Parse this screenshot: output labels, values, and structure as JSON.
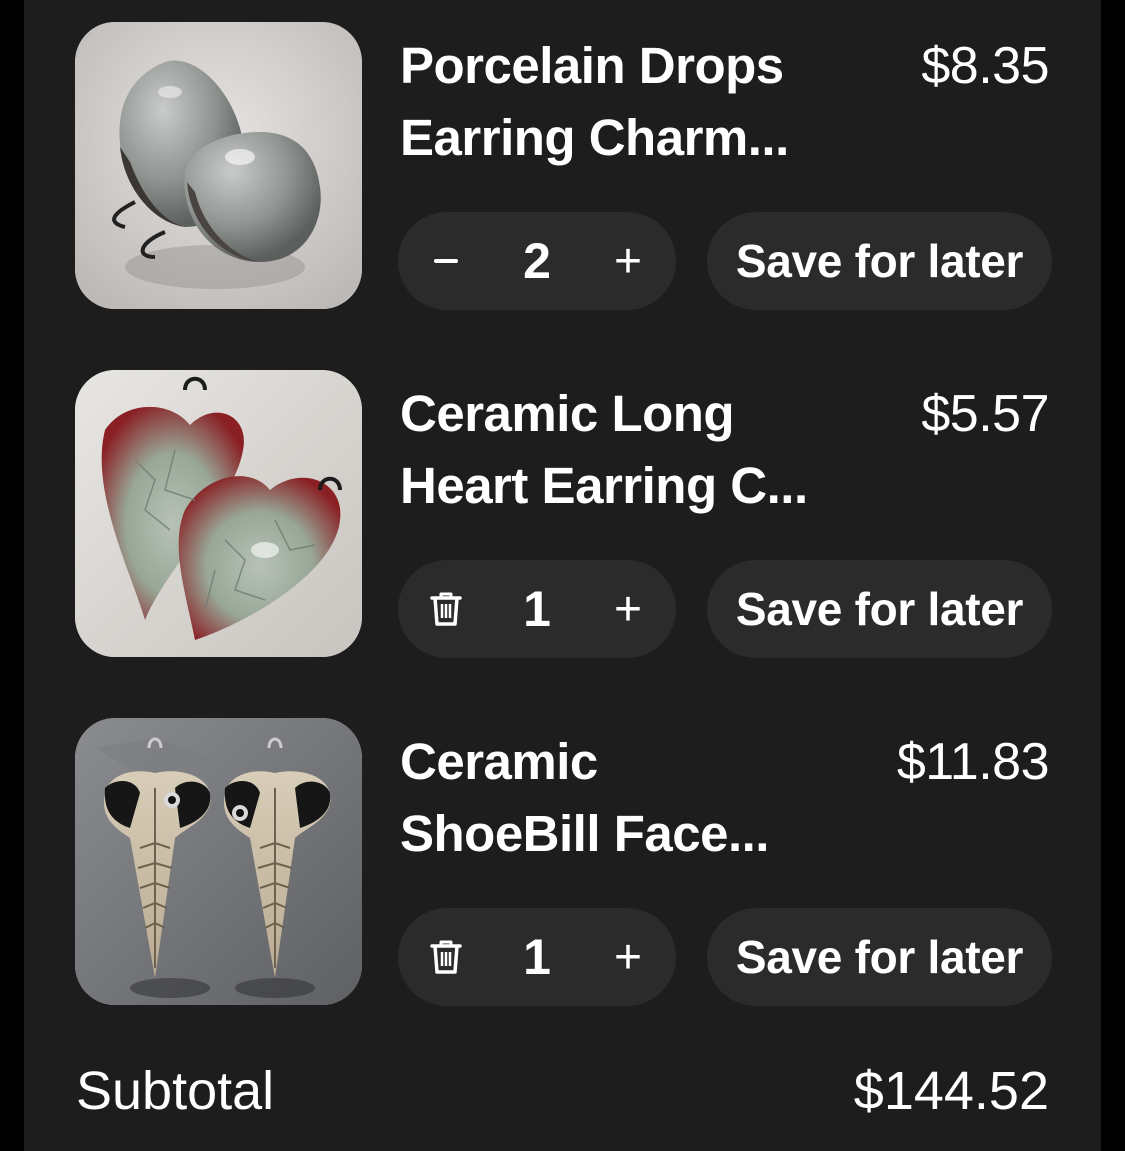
{
  "cart": {
    "items": [
      {
        "title_line1": "Porcelain Drops",
        "title_line2": "Earring Charm...",
        "price": "$8.35",
        "quantity": "2",
        "decrease_icon": "minus-icon",
        "increase_label": "+",
        "save_label": "Save for later",
        "image": "porcelain-drops-photo"
      },
      {
        "title_line1": "Ceramic Long",
        "title_line2": "Heart Earring C...",
        "price": "$5.57",
        "quantity": "1",
        "decrease_icon": "trash-icon",
        "increase_label": "+",
        "save_label": "Save for later",
        "image": "ceramic-heart-photo"
      },
      {
        "title_line1": "Ceramic",
        "title_line2": "ShoeBill Face...",
        "price": "$11.83",
        "quantity": "1",
        "decrease_icon": "trash-icon",
        "increase_label": "+",
        "save_label": "Save for later",
        "image": "shoebill-face-photo"
      }
    ],
    "subtotal_label": "Subtotal",
    "subtotal_value": "$144.52"
  },
  "colors": {
    "background": "#000000",
    "panel": "#1d1d1d",
    "button": "#2b2b2b",
    "text": "#ffffff"
  }
}
